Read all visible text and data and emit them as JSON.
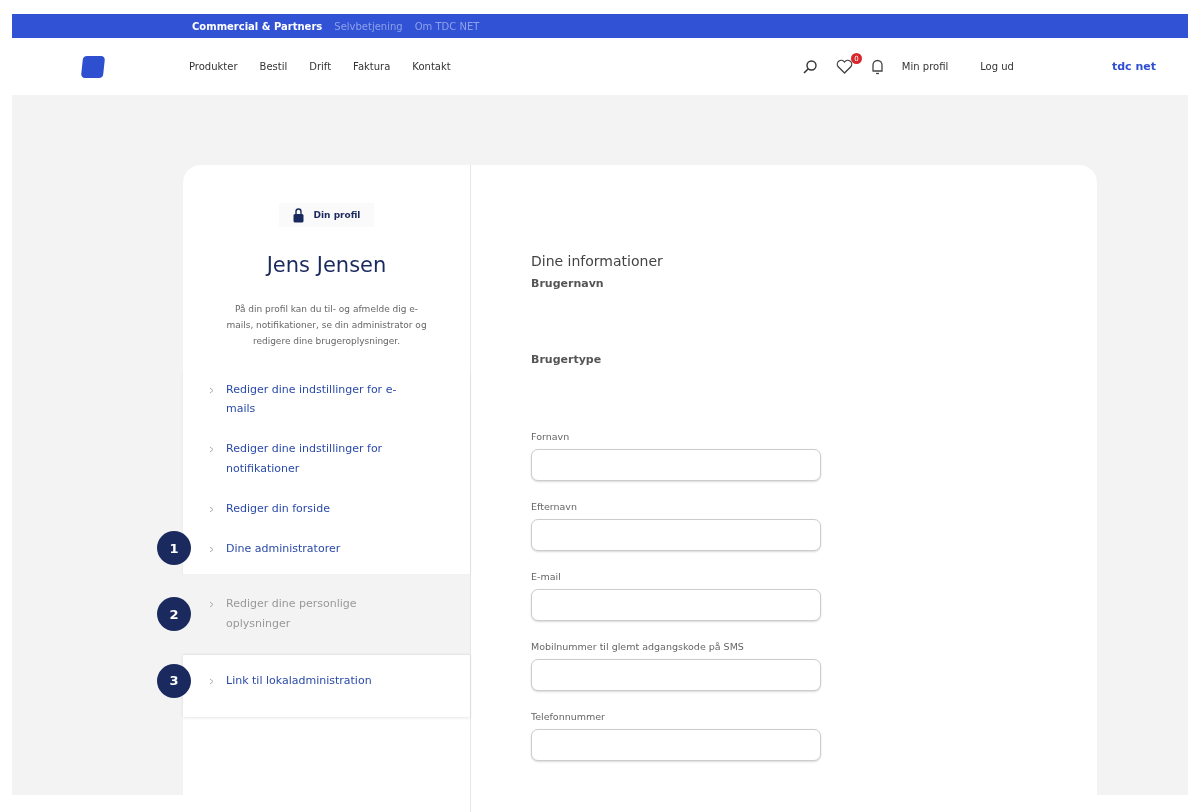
{
  "top_bar": {
    "links": [
      {
        "label": "Commercial & Partners",
        "selected": true
      },
      {
        "label": "Selvbetjening",
        "selected": false
      },
      {
        "label": "Om TDC NET",
        "selected": false
      }
    ]
  },
  "header": {
    "nav": [
      "Produkter",
      "Bestil",
      "Drift",
      "Faktura",
      "Kontakt"
    ],
    "favorites_badge": "0",
    "profile_link": "Min profil",
    "logout_link": "Log ud",
    "brand": "tdc net"
  },
  "sidebar": {
    "tag": "Din profil",
    "name": "Jens Jensen",
    "description": "På din profil kan du til- og afmelde dig e-mails, notifikationer, se din administrator og redigere dine brugeroplysninger.",
    "items": [
      {
        "label": "Rediger dine indstillinger for e-mails",
        "selected": false
      },
      {
        "label": "Rediger dine indstillinger for notifikationer",
        "selected": false
      },
      {
        "label": "Rediger din forside",
        "selected": false
      },
      {
        "label": "Dine administratorer",
        "selected": false,
        "marker": "1"
      },
      {
        "label": "Rediger dine personlige oplysninger",
        "selected": true,
        "marker": "2"
      },
      {
        "label": "Link til lokaladministration",
        "selected": false,
        "marker": "3"
      }
    ]
  },
  "form": {
    "title": "Dine informationer",
    "info": [
      {
        "label": "Brugernavn"
      },
      {
        "label": "Brugertype"
      }
    ],
    "fields": [
      {
        "label": "Fornavn"
      },
      {
        "label": "Efternavn"
      },
      {
        "label": "E-mail"
      },
      {
        "label": "Mobilnummer til glemt adgangskode på SMS"
      },
      {
        "label": "Telefonnummer"
      }
    ]
  }
}
